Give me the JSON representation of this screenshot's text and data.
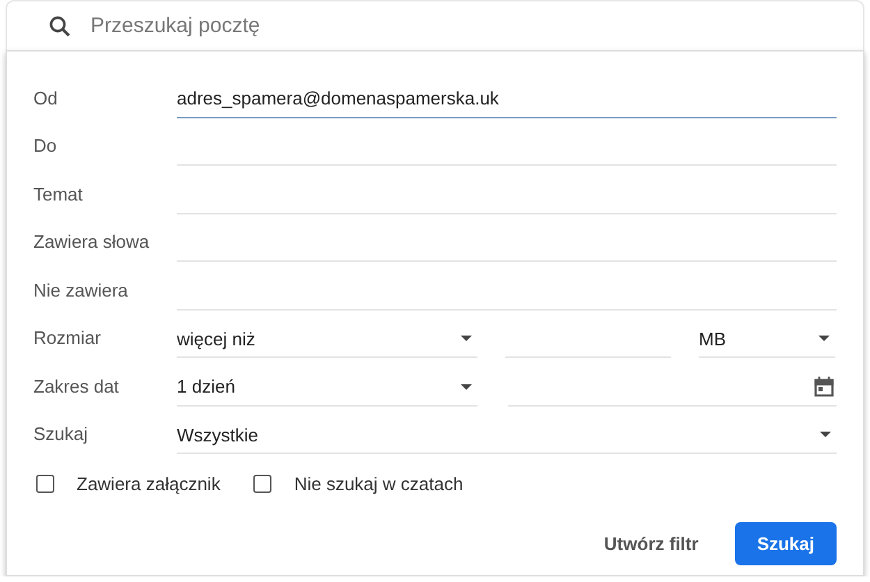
{
  "search": {
    "placeholder": "Przeszukaj pocztę"
  },
  "fields": [
    {
      "kind": "text",
      "label": "Od",
      "value": "adres_spamera@domenaspamerska.uk",
      "focused": true
    },
    {
      "kind": "text",
      "label": "Do",
      "focused": false
    },
    {
      "kind": "text",
      "label": "Temat",
      "focused": false
    },
    {
      "kind": "text",
      "label": "Zawiera słowa",
      "focused": false
    },
    {
      "kind": "text",
      "label": "Nie zawiera",
      "focused": false
    },
    {
      "kind": "size",
      "label": "Rozmiar",
      "operator": "więcej niż",
      "unit": "MB"
    },
    {
      "kind": "date",
      "label": "Zakres dat",
      "range": "1 dzień"
    },
    {
      "kind": "select",
      "label": "Szukaj",
      "value": "Wszystkie"
    }
  ],
  "checkboxes": [
    {
      "label": "Zawiera załącznik",
      "checked": false
    },
    {
      "label": "Nie szukaj w czatach",
      "checked": false
    }
  ],
  "buttons": [
    {
      "label": "Utwórz filtr",
      "kind": "text"
    },
    {
      "label": "Szukaj",
      "kind": "primary"
    }
  ]
}
